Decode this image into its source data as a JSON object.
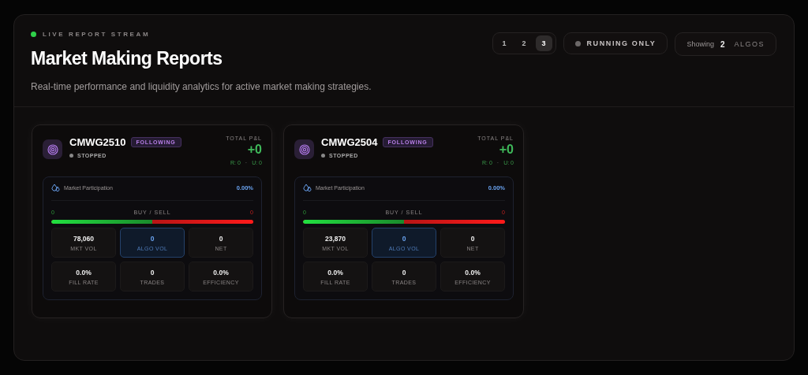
{
  "header": {
    "live_label": "LIVE REPORT STREAM",
    "title": "Market Making Reports",
    "subtitle": "Real-time performance and liquidity analytics for active market making strategies."
  },
  "pages": [
    {
      "label": "1",
      "selected": false
    },
    {
      "label": "2",
      "selected": false
    },
    {
      "label": "3",
      "selected": true
    }
  ],
  "running_filter": {
    "label": "RUNNING ONLY",
    "on": false
  },
  "showing": {
    "label": "Showing",
    "count": "2",
    "unit": "ALGOS"
  },
  "reports": [
    {
      "name": "CMWG2510",
      "badge": "FOLLOWING",
      "status": "STOPPED",
      "running": false,
      "pnl_label": "TOTAL P&L",
      "pnl": "+0",
      "realized": "R: 0",
      "sep": "·",
      "unrealized": "U: 0",
      "participation_label": "Market Participation",
      "participation": "0.00%",
      "buy": "0",
      "buysell_label": "BUY / SELL",
      "sell": "0",
      "level": 0.5,
      "stats": [
        {
          "value": "78,060",
          "label": "MKT VOL",
          "highlight": false
        },
        {
          "value": "0",
          "label": "ALGO VOL",
          "highlight": true
        },
        {
          "value": "0",
          "label": "NET",
          "highlight": false
        },
        {
          "value": "0.0%",
          "label": "FILL RATE",
          "highlight": false
        },
        {
          "value": "0",
          "label": "TRADES",
          "highlight": false
        },
        {
          "value": "0.0%",
          "label": "EFFICIENCY",
          "highlight": false
        }
      ]
    },
    {
      "name": "CMWG2504",
      "badge": "FOLLOWING",
      "status": "STOPPED",
      "running": false,
      "pnl_label": "TOTAL P&L",
      "pnl": "+0",
      "realized": "R: 0",
      "sep": "·",
      "unrealized": "U: 0",
      "participation_label": "Market Participation",
      "participation": "0.00%",
      "buy": "0",
      "buysell_label": "BUY / SELL",
      "sell": "0",
      "level": 0.5,
      "stats": [
        {
          "value": "23,870",
          "label": "MKT VOL",
          "highlight": false
        },
        {
          "value": "0",
          "label": "ALGO VOL",
          "highlight": true
        },
        {
          "value": "0",
          "label": "NET",
          "highlight": false
        },
        {
          "value": "0.0%",
          "label": "FILL RATE",
          "highlight": false
        },
        {
          "value": "0",
          "label": "TRADES",
          "highlight": false
        },
        {
          "value": "0.0%",
          "label": "EFFICIENCY",
          "highlight": false
        }
      ]
    }
  ]
}
